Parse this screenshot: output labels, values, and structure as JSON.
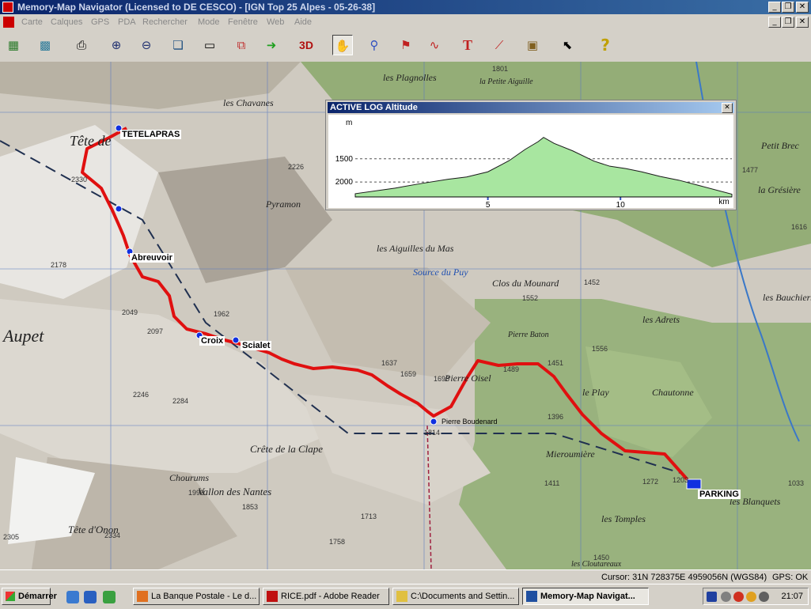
{
  "window": {
    "title": "Memory-Map Navigator (Licensed to DE CESCO) - [IGN Top 25 Alpes - 05-26-38]",
    "minimize": "_",
    "restore": "❐",
    "close": "✕"
  },
  "menu": {
    "items": [
      "Carte",
      "Calques",
      "GPS",
      "PDA",
      "Rechercher",
      "Mode",
      "Fenêtre",
      "Web",
      "Aide"
    ],
    "mdi_minimize": "_",
    "mdi_restore": "❐",
    "mdi_close": "✕"
  },
  "toolbar": {
    "buttons": [
      {
        "icon": "overview-map-icon",
        "glyph": "▦"
      },
      {
        "icon": "map-tiles-icon",
        "glyph": "▩"
      },
      {
        "icon": "print-icon",
        "glyph": "⎙"
      },
      {
        "icon": "zoom-in-icon",
        "glyph": "⊕"
      },
      {
        "icon": "zoom-out-icon",
        "glyph": "⊖"
      },
      {
        "icon": "copy-map-icon",
        "glyph": "❏"
      },
      {
        "icon": "window-icon",
        "glyph": "▭"
      },
      {
        "icon": "duplicate-icon",
        "glyph": "⧉"
      },
      {
        "icon": "go-arrow-icon",
        "glyph": "➜"
      },
      {
        "icon": "view-3d-icon",
        "glyph": "3D"
      },
      {
        "icon": "hand-pan-icon",
        "glyph": "✋"
      },
      {
        "icon": "route-icon",
        "glyph": "⚲"
      },
      {
        "icon": "marker-icon",
        "glyph": "⚑"
      },
      {
        "icon": "track-icon",
        "glyph": "∿"
      },
      {
        "icon": "text-tool-icon",
        "glyph": "T"
      },
      {
        "icon": "measure-icon",
        "glyph": "⟋"
      },
      {
        "icon": "gps-device-icon",
        "glyph": "▣"
      },
      {
        "icon": "select-cursor-icon",
        "glyph": "⬉"
      },
      {
        "icon": "help-icon",
        "glyph": "?"
      }
    ],
    "label_3d": "3D",
    "label_text": "T"
  },
  "map": {
    "waypoints": {
      "tetelapras": "TETELAPRAS",
      "abreuvoir": "Abreuvoir",
      "croix": "Croix",
      "scialet": "Scialet",
      "parking": "PARKING",
      "pierre_boudenard": "Pierre Boudenard"
    },
    "place_names": {
      "aupet": "Aupet",
      "tete_de": "Tête de",
      "les_aiguilles_du_mas": "les Aiguilles du Mas",
      "source_du_puy": "Source du Puy",
      "clos_du_mounard": "Clos du Mounard",
      "pierre_oisel": "Pierre Oisel",
      "le_play": "le Play",
      "chautonne": "Chautonne",
      "creve_de_la_clape": "Crête de la Clape",
      "vallon_des_nantes": "Vallon des Nantes",
      "les_tomples": "les Tomples",
      "les_blanquets": "les Blanquets",
      "chourums": "Chourums",
      "petit_brec": "Petit Brec",
      "la_gresiere": "la Grésière",
      "les_plagnolles": "les Plagnolles",
      "les_adrets": "les Adrets",
      "les_bauchiers": "les Bauchiers",
      "mieroumiere": "Mieroumière",
      "tete_d_onon": "Tête d'Onon",
      "petite_aiguille": "la Petite Aiguille",
      "les_chaveres": "les Chavanes",
      "pyramon": "Pyramon",
      "pierre_baton": "Pierre Baton",
      "les_cloutareaux": "les Cloutareaux"
    },
    "elevations": [
      "2330",
      "2178",
      "2049",
      "2097",
      "1962",
      "1637",
      "1659",
      "1698",
      "1489",
      "1451",
      "1556",
      "1552",
      "1452",
      "1396",
      "1272",
      "1203",
      "1411",
      "1993",
      "1853",
      "1713",
      "1758",
      "2284",
      "2246",
      "1801",
      "1477",
      "1033",
      "1616",
      "1450",
      "2305",
      "2334",
      "2226",
      "1814"
    ]
  },
  "profile": {
    "title": "ACTIVE LOG Altitude",
    "close": "✕",
    "y_unit": "m",
    "x_unit": "km",
    "y_ticks": [
      "2000",
      "1500"
    ],
    "x_ticks": [
      "5",
      "10"
    ]
  },
  "chart_data": {
    "type": "area",
    "title": "ACTIVE LOG Altitude",
    "xlabel": "km",
    "ylabel": "m",
    "xlim": [
      0,
      14.2
    ],
    "ylim": [
      1180,
      2880
    ],
    "y_ticks": [
      1500,
      2000
    ],
    "x_ticks": [
      5,
      10
    ],
    "grid": true,
    "fill_color": "#a8e6a0",
    "line_color": "#1a1a1a",
    "x": [
      0,
      1.5,
      2.5,
      3.5,
      4.2,
      5,
      5.8,
      6.4,
      6.9,
      7.1,
      7.5,
      8.2,
      9,
      9.6,
      10.2,
      10.8,
      11.5,
      12.2,
      13,
      14.2
    ],
    "y": [
      1250,
      1370,
      1470,
      1560,
      1610,
      1720,
      1960,
      2200,
      2370,
      2460,
      2330,
      2170,
      1950,
      1840,
      1790,
      1720,
      1620,
      1540,
      1420,
      1240
    ]
  },
  "status": {
    "cursor": "Cursor: 31N 728375E 4959056N (WGS84)",
    "gps": "GPS: OK"
  },
  "taskbar": {
    "start": "Démarrer",
    "tasks": [
      {
        "label": "La Banque Postale - Le d...",
        "color": "#e07020"
      },
      {
        "label": "RICE.pdf - Adobe Reader",
        "color": "#c01010"
      },
      {
        "label": "C:\\Documents and Settin...",
        "color": "#e0c040"
      },
      {
        "label": "Memory-Map Navigat...",
        "color": "#2050a0"
      }
    ],
    "clock": "21:07"
  }
}
